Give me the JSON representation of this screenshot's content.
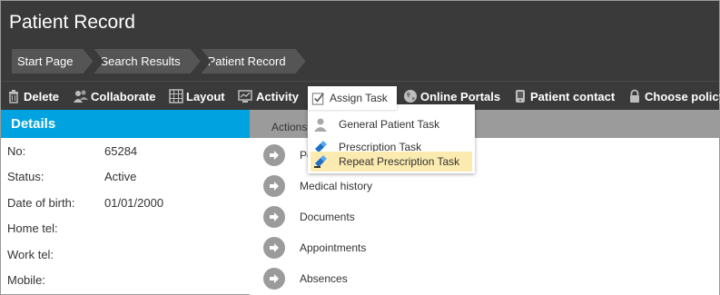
{
  "window": {
    "title": "Patient Record"
  },
  "breadcrumb": [
    "Start Page",
    "Search Results",
    "Patient Record"
  ],
  "toolbar": {
    "delete": "Delete",
    "collaborate": "Collaborate",
    "layout": "Layout",
    "activity": "Activity",
    "assign_task": "Assign Task",
    "online_portals": "Online Portals",
    "patient_contact": "Patient contact",
    "choose_policy": "Choose policy"
  },
  "assign_task_menu": [
    "General Patient Task",
    "Prescription Task",
    "Repeat Prescription Task"
  ],
  "details": {
    "heading": "Details",
    "fields": [
      {
        "label": "No:",
        "value": "65284"
      },
      {
        "label": "Status:",
        "value": "Active"
      },
      {
        "label": "Date of birth:",
        "value": "01/01/2000"
      },
      {
        "label": "Home tel:",
        "value": ""
      },
      {
        "label": "Work tel:",
        "value": ""
      },
      {
        "label": "Mobile:",
        "value": ""
      }
    ]
  },
  "actions": {
    "heading": "Actions",
    "items": [
      "Pe",
      "Medical history",
      "Documents",
      "Appointments",
      "Absences"
    ]
  },
  "colors": {
    "header": "#3a3a3a",
    "accent": "#00a3e0",
    "highlight": "#fcebb0",
    "actions_bar": "#9b9b9b"
  }
}
